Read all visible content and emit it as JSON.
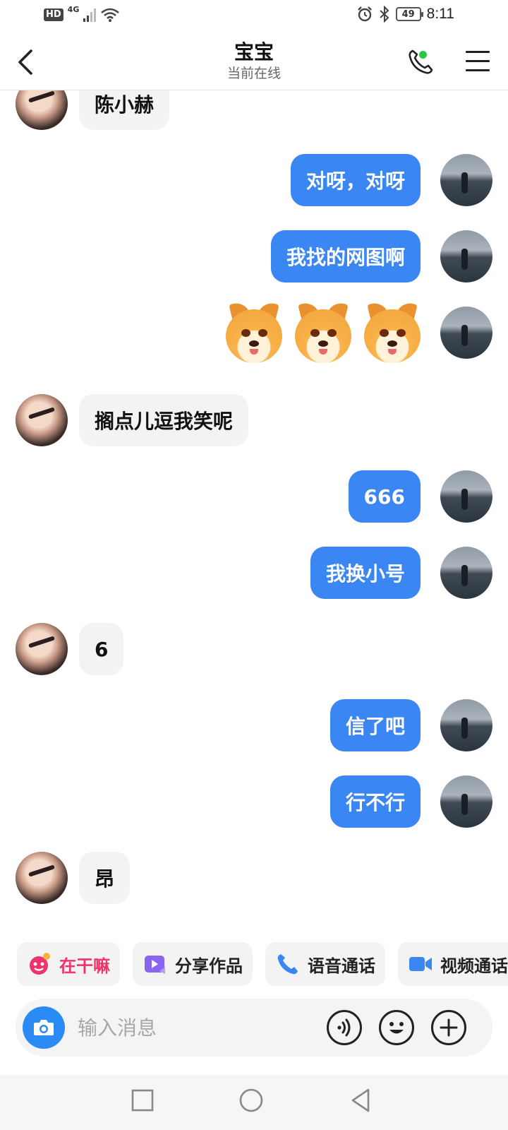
{
  "status_bar": {
    "hd": "HD",
    "network": "4G",
    "battery": "49",
    "time": "8:11"
  },
  "header": {
    "title": "宝宝",
    "subtitle": "当前在线",
    "online_color": "#28c840"
  },
  "messages": [
    {
      "from": "them",
      "type": "text",
      "text": "陈小赫"
    },
    {
      "from": "me",
      "type": "text",
      "text": "对呀，对呀"
    },
    {
      "from": "me",
      "type": "text",
      "text": "我找的网图啊"
    },
    {
      "from": "me",
      "type": "emoji",
      "emoji": [
        "doge",
        "doge",
        "doge"
      ]
    },
    {
      "from": "them",
      "type": "text",
      "text": "搁点儿逗我笑呢"
    },
    {
      "from": "me",
      "type": "text",
      "text": "666"
    },
    {
      "from": "me",
      "type": "text",
      "text": "我换小号"
    },
    {
      "from": "them",
      "type": "text",
      "text": "6"
    },
    {
      "from": "me",
      "type": "text",
      "text": "信了吧"
    },
    {
      "from": "me",
      "type": "text",
      "text": "行不行"
    },
    {
      "from": "them",
      "type": "text",
      "text": "昂"
    }
  ],
  "quick_actions": [
    {
      "label": "在干嘛",
      "icon": "smile-face-icon",
      "color": "#f0336b"
    },
    {
      "label": "分享作品",
      "icon": "share-video-icon",
      "color": "#8a63f0"
    },
    {
      "label": "语音通话",
      "icon": "phone-icon",
      "color": "#3a86f2"
    },
    {
      "label": "视频通话",
      "icon": "video-camera-icon",
      "color": "#3a86f2"
    }
  ],
  "input": {
    "placeholder": "输入消息"
  },
  "colors": {
    "accent": "#3a86f2",
    "camera_button": "#2b8bf4",
    "incoming_bubble": "#f3f3f3"
  }
}
